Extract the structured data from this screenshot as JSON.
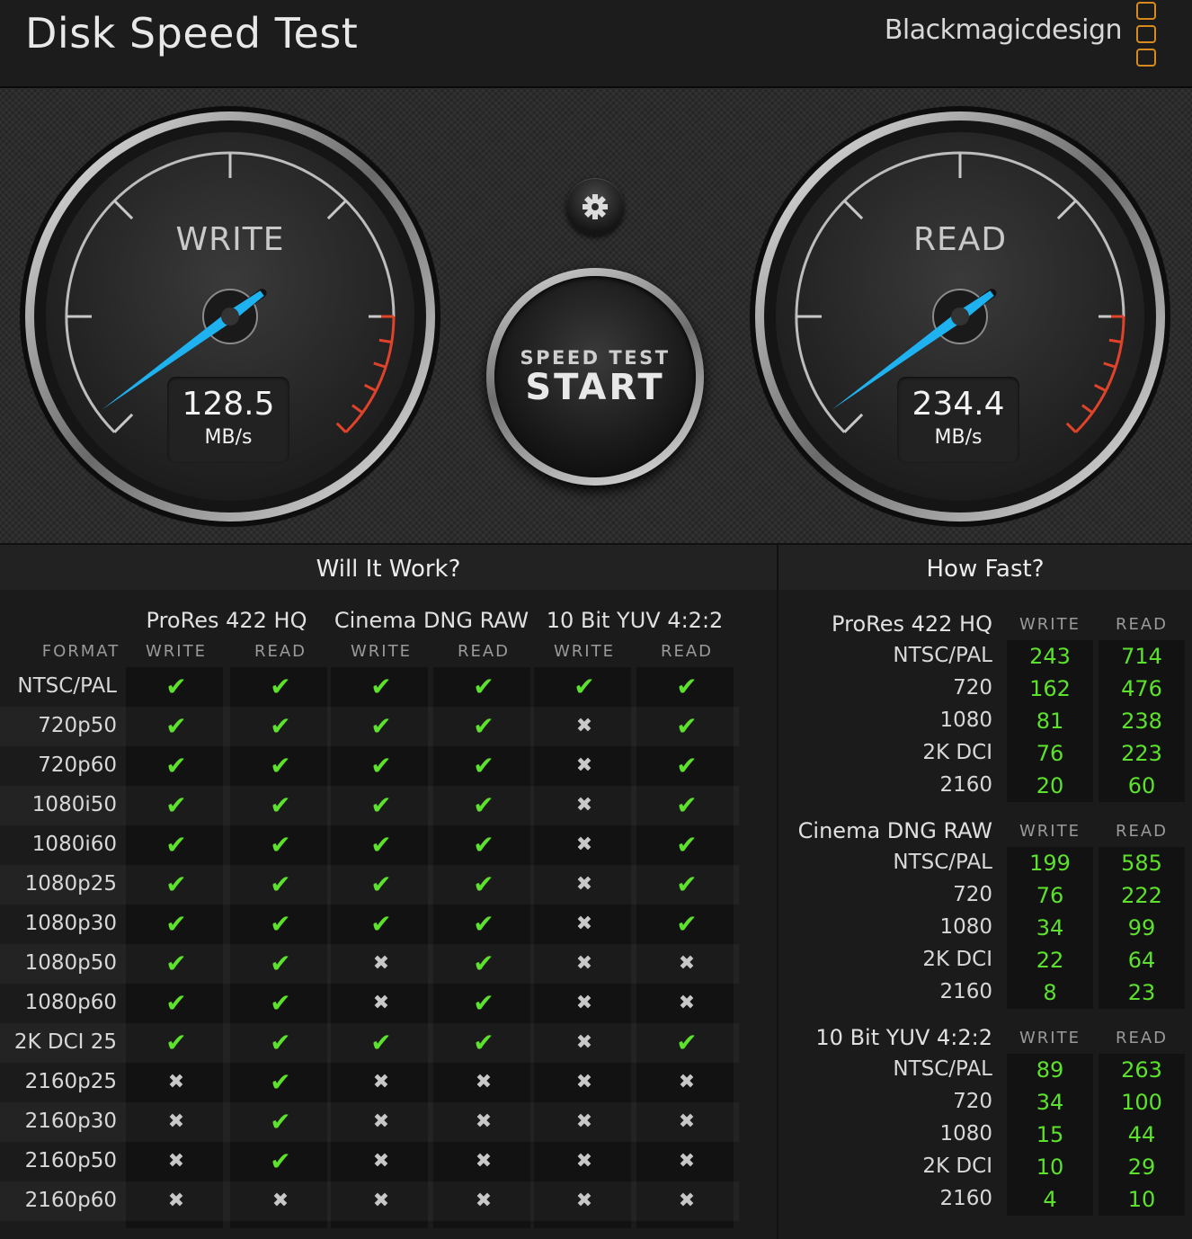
{
  "header": {
    "title": "Disk Speed Test",
    "brand": "Blackmagicdesign"
  },
  "write_gauge": {
    "label": "WRITE",
    "value": "128.5",
    "unit": "MB/s"
  },
  "read_gauge": {
    "label": "READ",
    "value": "234.4",
    "unit": "MB/s"
  },
  "start_button": {
    "small": "SPEED TEST",
    "big": "START"
  },
  "settings": {
    "icon": "gear-icon"
  },
  "will_it_work": {
    "title": "Will It Work?",
    "format_label": "FORMAT",
    "groups": [
      "ProRes 422 HQ",
      "Cinema DNG RAW",
      "10 Bit YUV 4:2:2"
    ],
    "sub": [
      "WRITE",
      "READ"
    ],
    "rows": [
      {
        "format": "NTSC/PAL",
        "marks": [
          1,
          1,
          1,
          1,
          1,
          1
        ]
      },
      {
        "format": "720p50",
        "marks": [
          1,
          1,
          1,
          1,
          0,
          1
        ]
      },
      {
        "format": "720p60",
        "marks": [
          1,
          1,
          1,
          1,
          0,
          1
        ]
      },
      {
        "format": "1080i50",
        "marks": [
          1,
          1,
          1,
          1,
          0,
          1
        ]
      },
      {
        "format": "1080i60",
        "marks": [
          1,
          1,
          1,
          1,
          0,
          1
        ]
      },
      {
        "format": "1080p25",
        "marks": [
          1,
          1,
          1,
          1,
          0,
          1
        ]
      },
      {
        "format": "1080p30",
        "marks": [
          1,
          1,
          1,
          1,
          0,
          1
        ]
      },
      {
        "format": "1080p50",
        "marks": [
          1,
          1,
          0,
          1,
          0,
          0
        ]
      },
      {
        "format": "1080p60",
        "marks": [
          1,
          1,
          0,
          1,
          0,
          0
        ]
      },
      {
        "format": "2K DCI 25",
        "marks": [
          1,
          1,
          1,
          1,
          0,
          1
        ]
      },
      {
        "format": "2160p25",
        "marks": [
          0,
          1,
          0,
          0,
          0,
          0
        ]
      },
      {
        "format": "2160p30",
        "marks": [
          0,
          1,
          0,
          0,
          0,
          0
        ]
      },
      {
        "format": "2160p50",
        "marks": [
          0,
          1,
          0,
          0,
          0,
          0
        ]
      },
      {
        "format": "2160p60",
        "marks": [
          0,
          0,
          0,
          0,
          0,
          0
        ]
      }
    ]
  },
  "how_fast": {
    "title": "How Fast?",
    "sub": [
      "WRITE",
      "READ"
    ],
    "groups": [
      {
        "name": "ProRes 422 HQ",
        "rows": [
          {
            "res": "NTSC/PAL",
            "write": "243",
            "read": "714"
          },
          {
            "res": "720",
            "write": "162",
            "read": "476"
          },
          {
            "res": "1080",
            "write": "81",
            "read": "238"
          },
          {
            "res": "2K DCI",
            "write": "76",
            "read": "223"
          },
          {
            "res": "2160",
            "write": "20",
            "read": "60"
          }
        ]
      },
      {
        "name": "Cinema DNG RAW",
        "rows": [
          {
            "res": "NTSC/PAL",
            "write": "199",
            "read": "585"
          },
          {
            "res": "720",
            "write": "76",
            "read": "222"
          },
          {
            "res": "1080",
            "write": "34",
            "read": "99"
          },
          {
            "res": "2K DCI",
            "write": "22",
            "read": "64"
          },
          {
            "res": "2160",
            "write": "8",
            "read": "23"
          }
        ]
      },
      {
        "name": "10 Bit YUV 4:2:2",
        "rows": [
          {
            "res": "NTSC/PAL",
            "write": "89",
            "read": "263"
          },
          {
            "res": "720",
            "write": "34",
            "read": "100"
          },
          {
            "res": "1080",
            "write": "15",
            "read": "44"
          },
          {
            "res": "2K DCI",
            "write": "10",
            "read": "29"
          },
          {
            "res": "2160",
            "write": "4",
            "read": "10"
          }
        ]
      }
    ]
  },
  "colors": {
    "ok": "#5ce12c",
    "needle": "#1fb2f0",
    "redline": "#e0432a",
    "logo": "#d88a1c"
  }
}
